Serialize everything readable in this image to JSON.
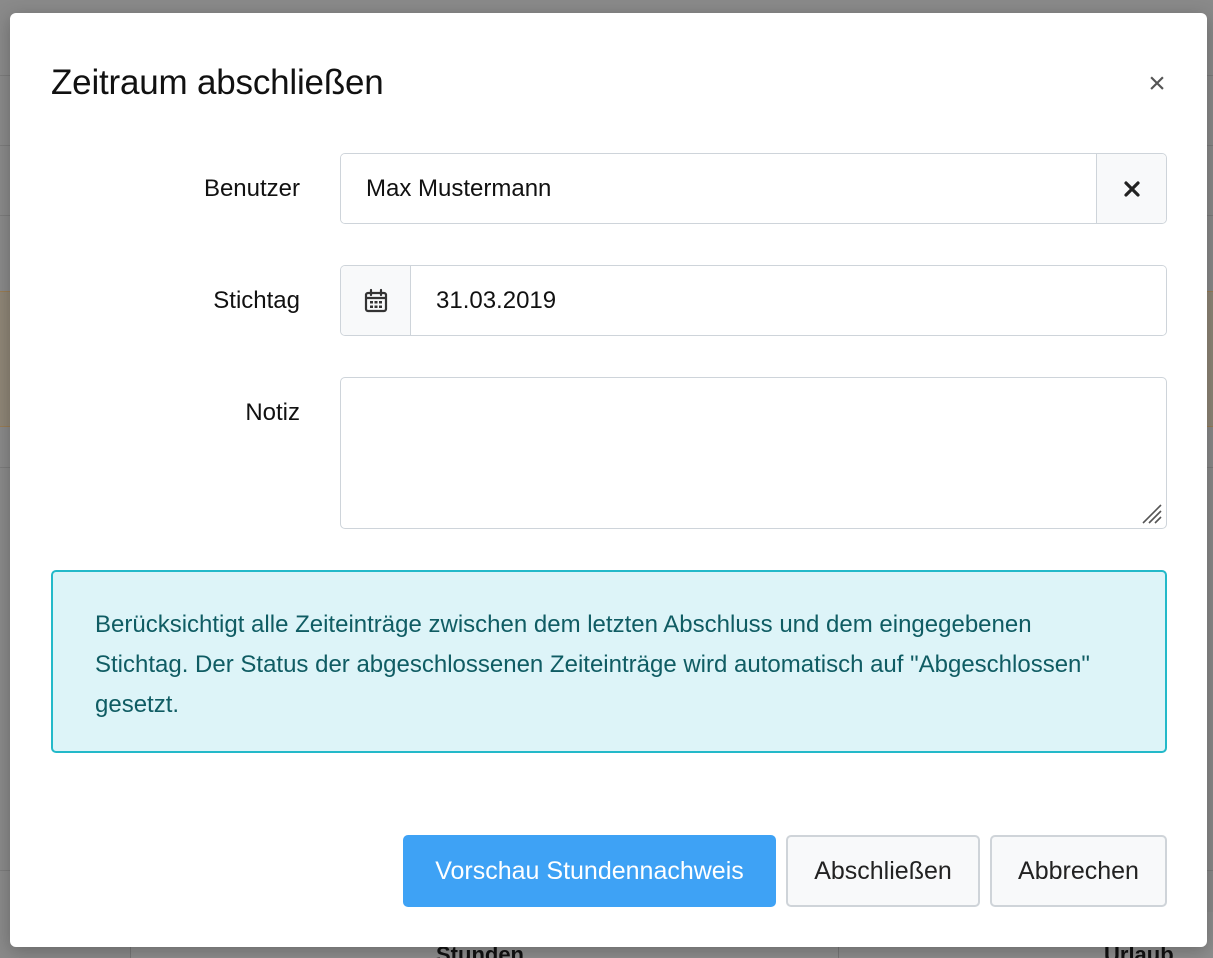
{
  "modal": {
    "title": "Zeitraum abschließen",
    "close_glyph": "×"
  },
  "form": {
    "user": {
      "label": "Benutzer",
      "value": "Max Mustermann",
      "clear_icon": "x-icon"
    },
    "date": {
      "label": "Stichtag",
      "value": "31.03.2019",
      "calendar_icon": "calendar-icon"
    },
    "note": {
      "label": "Notiz",
      "value": ""
    }
  },
  "info": {
    "text": "Berücksichtigt alle Zeiteinträge zwischen dem letzten Abschluss und dem eingegebenen Stichtag. Der Status der abgeschlossenen Zeiteinträge wird automatisch auf \"Abgeschlossen\" gesetzt."
  },
  "buttons": {
    "preview": "Vorschau Stundennachweis",
    "close_period": "Abschließen",
    "cancel": "Abbrechen"
  },
  "background": {
    "footer_left": "Stunden",
    "footer_right": "Urlaub"
  },
  "colors": {
    "primary": "#3ea2f5",
    "info_bg": "#ddf4f8",
    "info_border": "#23b9c9",
    "info_text": "#0f5c63",
    "overlay": "#8a8a8a"
  }
}
